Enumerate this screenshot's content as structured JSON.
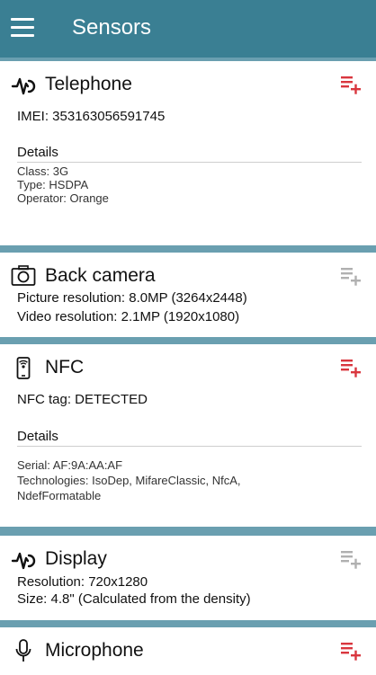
{
  "app_bar": {
    "title": "Sensors",
    "menu_icon": "hamburger-menu-icon"
  },
  "colors": {
    "app_bar": "#3a7f93",
    "background": "#6a9fb0",
    "add_active": "#d9363e",
    "add_inactive": "#b0b0b0"
  },
  "cards": {
    "telephone": {
      "name": "Telephone",
      "icon": "signal-wave-icon",
      "imei": "IMEI: 353163056591745",
      "details_title": "Details",
      "details": [
        "Class: 3G",
        "Type: HSDPA",
        "Operator: Orange"
      ]
    },
    "camera": {
      "name": "Back camera",
      "icon": "camera-icon",
      "lines": [
        "Picture resolution: 8.0MP (3264x2448)",
        "Video resolution: 2.1MP (1920x1080)"
      ]
    },
    "nfc": {
      "name": "NFC",
      "icon": "nfc-phone-icon",
      "tag": "NFC tag: DETECTED",
      "details_title": "Details",
      "details": [
        "Serial: AF:9A:AA:AF",
        "Technologies: IsoDep, MifareClassic, NfcA,",
        "NdefFormatable"
      ]
    },
    "display": {
      "name": "Display",
      "icon": "signal-wave-icon",
      "lines": [
        "Resolution: 720x1280",
        "Size: 4.8\" (Calculated from the density)"
      ]
    },
    "microphone": {
      "name": "Microphone",
      "icon": "microphone-icon"
    }
  }
}
